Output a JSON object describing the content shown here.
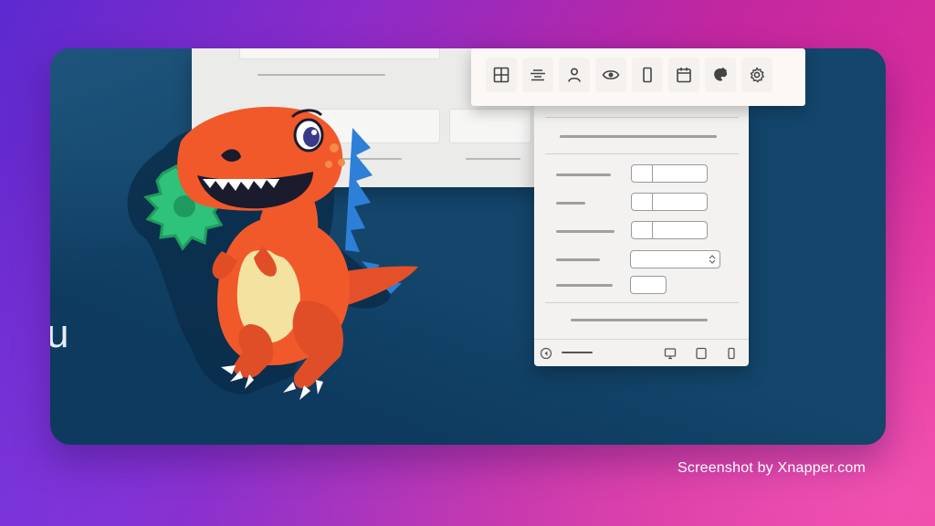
{
  "background": {
    "gradient_colors": [
      "#5b2ad0",
      "#c2279f",
      "#e8329b"
    ]
  },
  "card": {
    "color": "#0e3a5f",
    "partial_letter": "u"
  },
  "toolbar": {
    "buttons": [
      {
        "name": "layout-grid-icon"
      },
      {
        "name": "align-center-icon"
      },
      {
        "name": "user-icon"
      },
      {
        "name": "eye-icon"
      },
      {
        "name": "mobile-frame-icon"
      },
      {
        "name": "calendar-icon"
      },
      {
        "name": "palette-icon"
      },
      {
        "name": "gear-icon"
      }
    ]
  },
  "settings_panel": {
    "fields": [
      "text-stepper",
      "text-stepper",
      "text-stepper",
      "select",
      "text-input"
    ],
    "footer_icons": [
      "back-arrow-icon",
      "desktop-icon",
      "tablet-icon",
      "mobile-icon"
    ]
  },
  "illustration": {
    "name": "orange-dinosaur-with-gear",
    "colors": {
      "dino": "#f2592a",
      "gear": "#2fc27a",
      "belly": "#f4e3a0",
      "spikes": "#2e7fd8"
    }
  },
  "credit": {
    "text": "Screenshot by Xnapper.com"
  }
}
